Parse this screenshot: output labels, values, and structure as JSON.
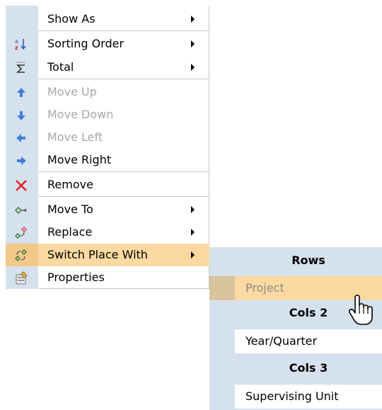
{
  "menu": {
    "items": [
      {
        "label": "Show As",
        "icon": "none",
        "submenu": true,
        "enabled": true
      },
      {
        "label": "Sorting Order",
        "icon": "sort-az-icon",
        "submenu": true,
        "enabled": true
      },
      {
        "label": "Total",
        "icon": "sigma-icon",
        "submenu": true,
        "enabled": true
      },
      {
        "label": "Move Up",
        "icon": "arrow-up-icon",
        "submenu": false,
        "enabled": false
      },
      {
        "label": "Move Down",
        "icon": "arrow-down-icon",
        "submenu": false,
        "enabled": false
      },
      {
        "label": "Move Left",
        "icon": "arrow-left-icon",
        "submenu": false,
        "enabled": false
      },
      {
        "label": "Move Right",
        "icon": "arrow-right-icon",
        "submenu": false,
        "enabled": true
      },
      {
        "label": "Remove",
        "icon": "red-x-icon",
        "submenu": false,
        "enabled": true
      },
      {
        "label": "Move To",
        "icon": "move-to-icon",
        "submenu": true,
        "enabled": true
      },
      {
        "label": "Replace",
        "icon": "replace-icon",
        "submenu": true,
        "enabled": true
      },
      {
        "label": "Switch Place With",
        "icon": "switch-place-icon",
        "submenu": true,
        "enabled": true,
        "highlighted": true
      },
      {
        "label": "Properties",
        "icon": "properties-icon",
        "submenu": false,
        "enabled": true
      }
    ]
  },
  "submenu": {
    "groups": [
      {
        "header": "Rows",
        "items": [
          "Project"
        ]
      },
      {
        "header": "Cols 2",
        "items": [
          "Year/Quarter"
        ]
      },
      {
        "header": "Cols 3",
        "items": [
          "Supervising Unit"
        ]
      }
    ]
  },
  "colors": {
    "gutter": "#d6e1ee",
    "highlight": "#fbd9a0",
    "disabled_text": "#a7a7a7"
  }
}
